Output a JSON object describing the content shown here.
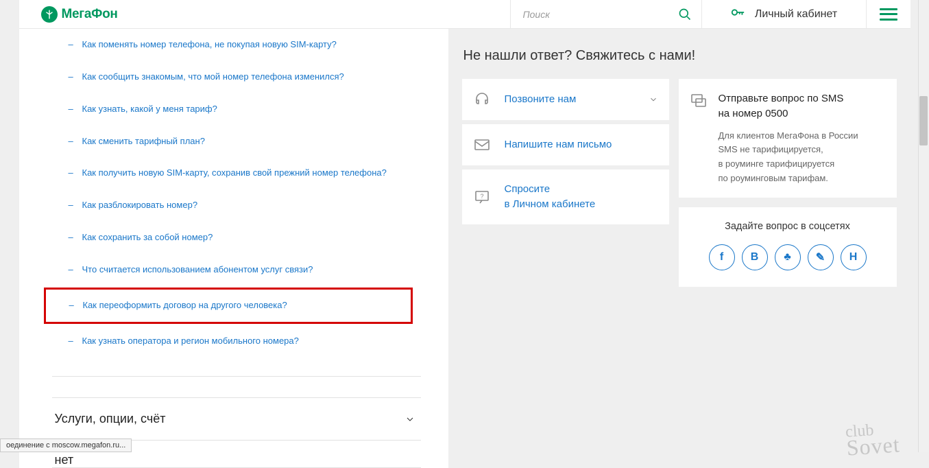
{
  "header": {
    "logo_text": "МегаФон",
    "search_placeholder": "Поиск",
    "lk_label": "Личный кабинет"
  },
  "faq": {
    "items": [
      {
        "text": "Как поменять номер телефона, не покупая новую SIM-карту?"
      },
      {
        "text": "Как сообщить знакомым, что мой номер телефона изменился?"
      },
      {
        "text": "Как узнать, какой у меня тариф?"
      },
      {
        "text": "Как сменить тарифный план?"
      },
      {
        "text": "Как получить новую SIM-карту, сохранив свой прежний номер телефона?"
      },
      {
        "text": "Как разблокировать номер?"
      },
      {
        "text": "Как сохранить за собой номер?"
      },
      {
        "text": "Что считается использованием абонентом услуг связи?"
      },
      {
        "text": "Как переоформить договор на другого человека?",
        "highlight": true
      },
      {
        "text": "Как узнать оператора и регион мобильного номера?"
      }
    ],
    "accordion_label": "Услуги, опции, счёт",
    "accordion_label_2": "нет"
  },
  "contact": {
    "heading": "Не нашли ответ? Свяжитесь с нами!",
    "cards": {
      "call": "Позвоните нам",
      "write": "Напишите нам письмо",
      "ask_line1": "Спросите",
      "ask_line2": "в Личном кабинете"
    },
    "sms": {
      "title_line1": "Отправьте вопрос по SMS",
      "title_line2": "на номер 0500",
      "note_line1": "Для клиентов МегаФона в России",
      "note_line2": "SMS не тарифицируется,",
      "note_line3": "в роуминге тарифицируется",
      "note_line4": "по роуминговым тарифам."
    },
    "social": {
      "title": "Задайте вопрос в соцсетях",
      "icons": [
        "f",
        "В",
        "♣",
        "✎",
        "Н"
      ]
    }
  },
  "watermark": {
    "l1": "club",
    "l2": "Sovet"
  },
  "statusbar": "оединение с moscow.megafon.ru..."
}
